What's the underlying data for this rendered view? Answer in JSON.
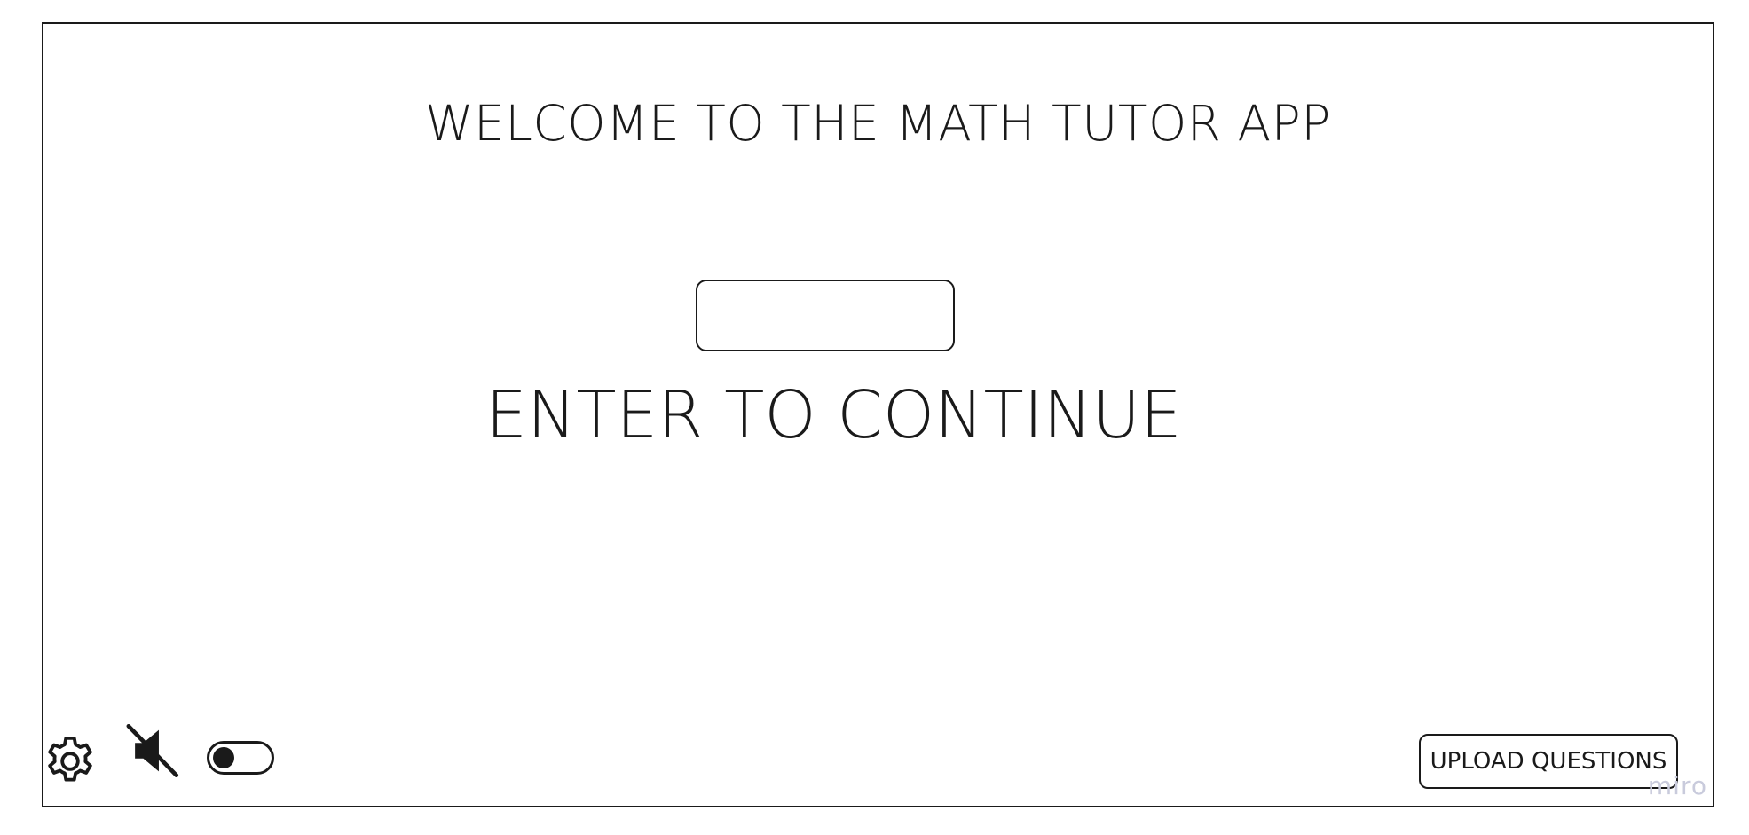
{
  "app": {
    "title": "WELCOME TO THE MATH TUTOR APP"
  },
  "entry": {
    "input_value": "",
    "input_placeholder": "",
    "label": "ENTER TO CONTINUE"
  },
  "footer": {
    "settings_icon": "gear-icon",
    "sound_icon": "speaker-muted-icon",
    "toggle_state": "off",
    "upload_button_label": "UPLOAD QUESTIONS"
  },
  "watermark": "miro",
  "colors": {
    "ink": "#1a1a1a",
    "background": "#ffffff",
    "watermark": "#c9cbdc"
  }
}
